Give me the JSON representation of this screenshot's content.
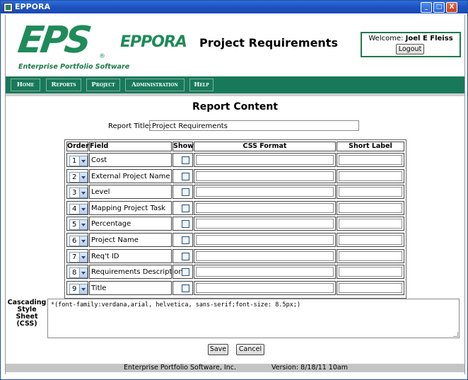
{
  "window": {
    "title": "EPPORA",
    "minimize": "_",
    "maximize": "□",
    "close": "X"
  },
  "header": {
    "logo_letters": "EPS",
    "logo_registered": "®",
    "logo_tagline": "Enterprise Portfolio Software",
    "product_logo": "EPPORA",
    "page_title": "Project Requirements",
    "welcome_label": "Welcome:",
    "user_name": "Joel E Fleiss",
    "logout_label": "Logout"
  },
  "nav": {
    "items": [
      {
        "label": "Home"
      },
      {
        "label": "Reports"
      },
      {
        "label": "Project"
      },
      {
        "label": "Administration"
      },
      {
        "label": "Help"
      }
    ]
  },
  "report": {
    "section_title": "Report Content",
    "title_label": "Report Title:",
    "title_value": "Project Requirements"
  },
  "table": {
    "headers": {
      "order": "Order",
      "field": "Field",
      "show": "Show",
      "css": "CSS Format",
      "short": "Short Label"
    },
    "rows": [
      {
        "order": "1",
        "field": "Cost"
      },
      {
        "order": "2",
        "field": "External Project Name"
      },
      {
        "order": "3",
        "field": "Level"
      },
      {
        "order": "4",
        "field": "Mapping Project Task"
      },
      {
        "order": "5",
        "field": "Percentage"
      },
      {
        "order": "6",
        "field": "Project Name"
      },
      {
        "order": "7",
        "field": "Req't ID"
      },
      {
        "order": "8",
        "field": "Requirements Description"
      },
      {
        "order": "9",
        "field": "Title"
      }
    ]
  },
  "css": {
    "label_line1": "Cascading",
    "label_line2": "Style",
    "label_line3": "Sheet",
    "label_line4": "(CSS)",
    "value": "*(font-family:verdana,arial, helvetica, sans-serif;font-size: 8.5px;)"
  },
  "actions": {
    "save": "Save",
    "cancel": "Cancel"
  },
  "footer": {
    "company": "Enterprise Portfolio Software, Inc.",
    "version": "Version: 8/18/11 10am"
  },
  "colors": {
    "brand_green": "#18795a",
    "titlebar_blue": "#1d52c0"
  }
}
